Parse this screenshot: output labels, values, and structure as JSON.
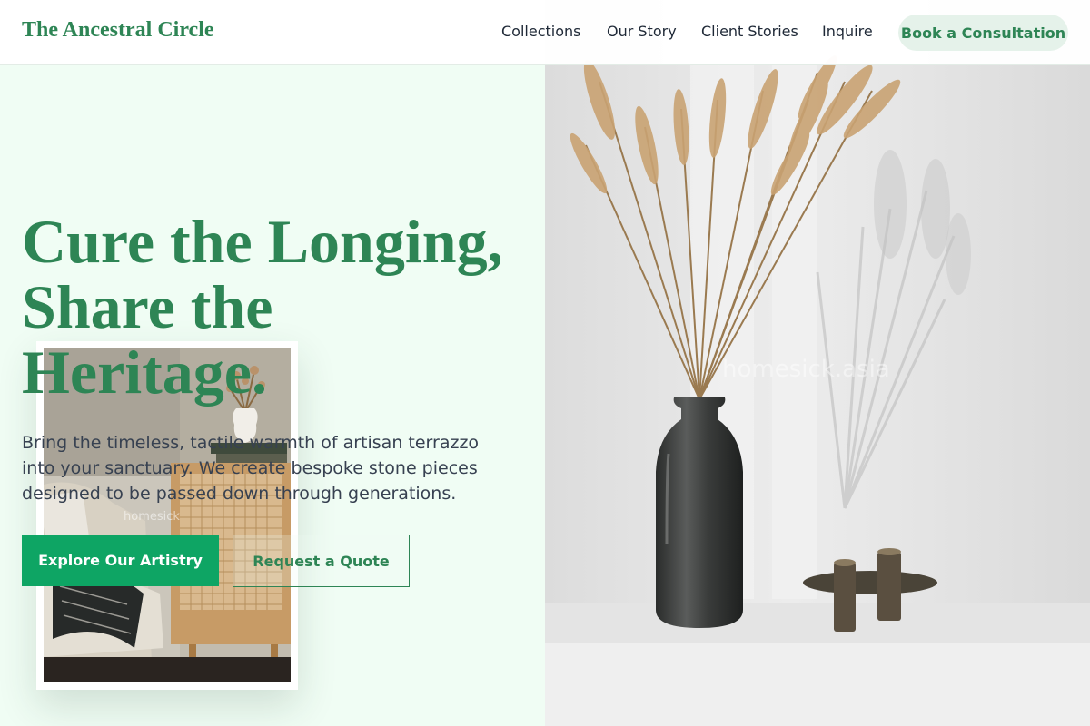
{
  "header": {
    "brand": "The Ancestral Circle",
    "nav": [
      "Collections",
      "Our Story",
      "Client Stories",
      "Inquire"
    ],
    "cta": "Book a Consultation"
  },
  "hero": {
    "title_lines": [
      "Cure the Longing,",
      "Share the",
      "Heritage."
    ],
    "description": "Bring the timeless, tactile warmth of artisan terrazzo into your sanctuary. We create bespoke stone pieces designed to be passed down through generations.",
    "primary_button": "Explore Our Artistry",
    "secondary_button": "Request a Quote"
  },
  "images": {
    "interior_watermark": "homesick",
    "vase_watermark": "homesick.asia"
  },
  "colors": {
    "brand_green": "#2e8555",
    "cta_green": "#0ea564",
    "pill_bg": "#e5f2ea",
    "hero_bg": "#f0fdf4"
  }
}
